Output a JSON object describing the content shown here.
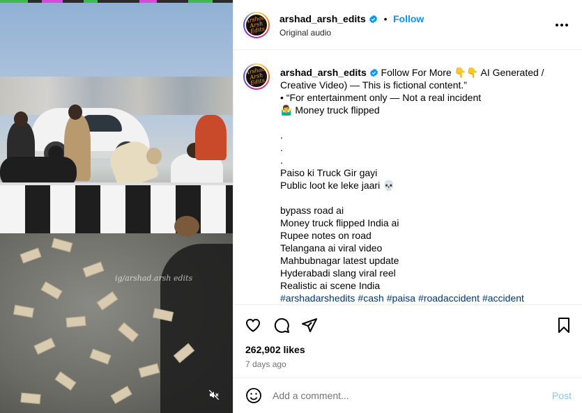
{
  "post": {
    "username": "arshad_arsh_edits",
    "follow_label": "Follow",
    "separator": "•",
    "audio": "Original audio",
    "avatar_text": "Arshad Arsh Edits",
    "media_watermark": "ig/arshad.arsh edits"
  },
  "caption": {
    "username": "arshad_arsh_edits",
    "first_line": " Follow For More 👇👇 AI Generated / Creative Video) — This is fictional content.”",
    "lines": [
      "• “For entertainment only — Not a real incident",
      "🤷‍♂️ Money truck flipped",
      "",
      ".",
      ".",
      ".",
      "Paiso ki Truck Gir gayi",
      "Public loot ke leke jaari 💀",
      "",
      "bypass road ai",
      "Money truck flipped India ai",
      "Rupee notes on road",
      "Telangana ai viral video",
      "Mahbubnagar latest update",
      "Hyderabadi slang viral reel",
      "Realistic ai scene India"
    ],
    "hashtags": [
      "#arshadarshedits",
      "#cash",
      "#paisa",
      "#roadaccident",
      "#accident"
    ]
  },
  "stats": {
    "likes": "262,902 likes",
    "date": "7 days ago"
  },
  "comment": {
    "placeholder": "Add a comment...",
    "post_label": "Post"
  },
  "colors": {
    "follow": "#0095f6",
    "hashtag": "#00376b",
    "post_disabled": "#85c6f9",
    "muted_text": "#737373"
  },
  "icons": {
    "like": "heart-icon",
    "comment": "comment-icon",
    "share": "share-icon",
    "save": "bookmark-icon",
    "more": "more-options-icon",
    "mute": "audio-muted-icon",
    "emoji": "emoji-icon",
    "verified": "verified-badge-icon"
  }
}
